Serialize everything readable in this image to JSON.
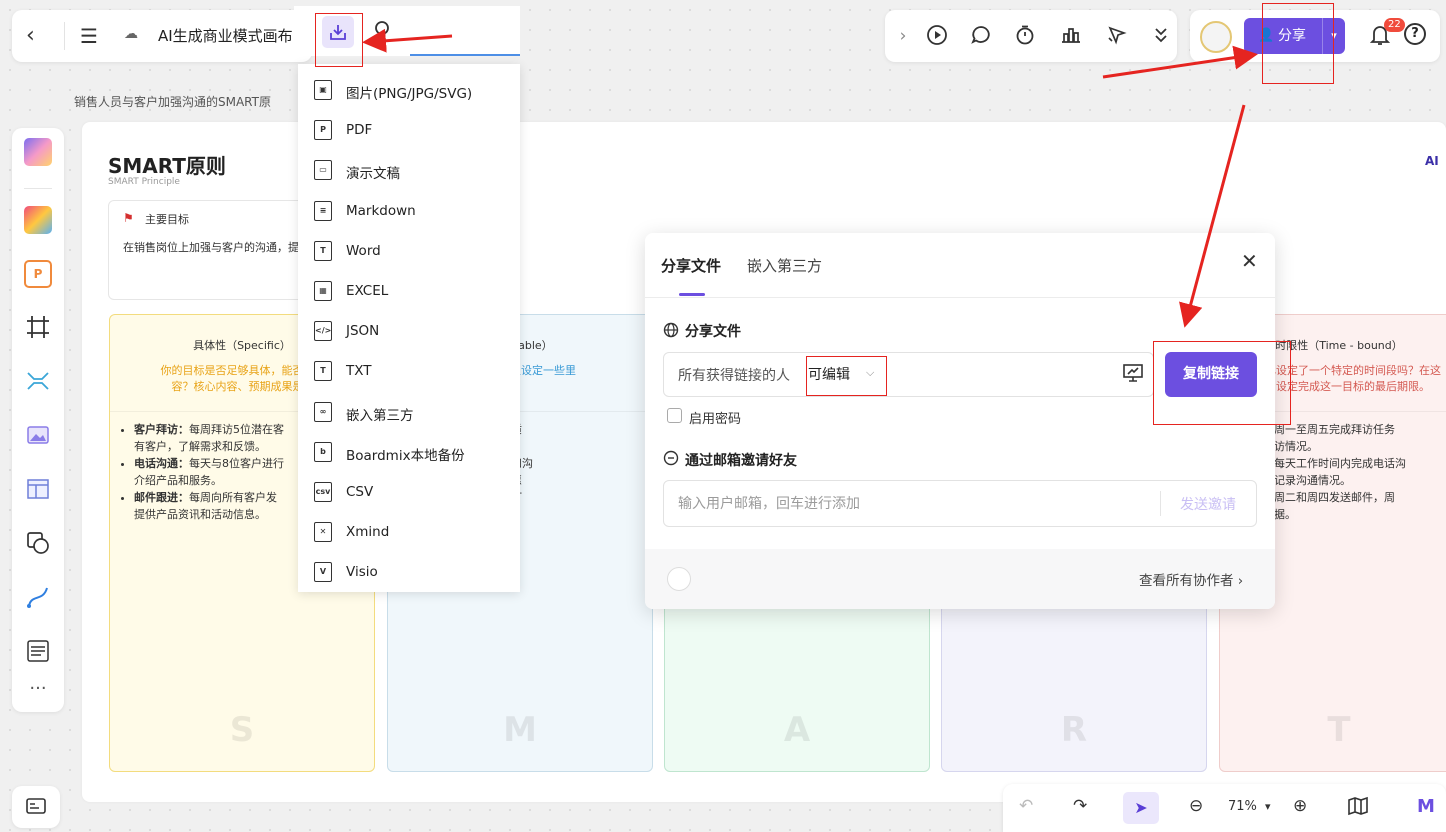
{
  "topbar": {
    "back": "‹",
    "menu": "☰",
    "cloud": "☁",
    "doc_title": "AI生成商业模式画布",
    "tools": [
      "play-icon",
      "comment-icon",
      "timer-icon",
      "vote-icon",
      "laser-pointer-icon",
      "collapse-icon"
    ],
    "chevron": "›",
    "share_label": "分享",
    "notification_count": "22",
    "help": "?"
  },
  "canvas": {
    "breadcrumb": "销售人员与客户加强沟通的SMART原",
    "title": "SMART原则",
    "subtitle": "SMART Principle",
    "logo_text": "AI",
    "goal": {
      "label": "主要目标",
      "text": "在销售岗位上加强与客户的沟通，提"
    },
    "columns": [
      {
        "letter": "S",
        "header": "具体性（Specific）",
        "question": "你的目标是否足够具体，能否清楚\n容？核心内容、预期成果是什",
        "bullets": [
          {
            "head": "客户拜访：",
            "text": "每周拜访5位潜在客\n有客户，了解需求和反馈。"
          },
          {
            "head": "电话沟通：",
            "text": "每天与8位客户进行\n介绍产品和服务。"
          },
          {
            "head": "邮件跟进：",
            "text": "每周向所有客户发\n提供产品资讯和活动信息。"
          }
        ]
      },
      {
        "letter": "M",
        "header": "easurable）",
        "question": "动？在这里设定一些里",
        "bullets": [
          {
            "head": "",
            "text": "计拜访客户的数量和质\n反馈和意向程度评估。"
          },
          {
            "head": "",
            "text": "通话沟通的客户数量和沟\n客户的兴趣和购买意愿"
          },
          {
            "head": "",
            "text": "计邮件的发送数量和打"
          }
        ]
      },
      {
        "letter": "A",
        "header": "",
        "question": "",
        "bullets": []
      },
      {
        "letter": "R",
        "header": "",
        "question": "",
        "bullets": []
      },
      {
        "letter": "T",
        "header": "时限性（Time - bound）",
        "question": "已设定了一个特定的时间段吗？在这\n设定完成这一目标的最后期限。",
        "bullets": [
          {
            "head": "拜访：",
            "text": "每周一至周五完成拜访任务\n六统计拜访情况。"
          },
          {
            "head": "话沟通：",
            "text": "每天工作时间内完成电话沟\n，下班前记录沟通情况。"
          },
          {
            "head": "跟进：",
            "text": "每周二和周四发送邮件，周\n计邮件数据。"
          }
        ]
      }
    ]
  },
  "export_menu": {
    "items": [
      {
        "icon": "image-icon",
        "glyph": "▣",
        "label": "图片(PNG/JPG/SVG)"
      },
      {
        "icon": "pdf-icon",
        "glyph": "P",
        "label": "PDF"
      },
      {
        "icon": "presentation-icon",
        "glyph": "▭",
        "label": "演示文稿"
      },
      {
        "icon": "markdown-icon",
        "glyph": "≡",
        "label": "Markdown"
      },
      {
        "icon": "word-icon",
        "glyph": "T",
        "label": "Word"
      },
      {
        "icon": "excel-icon",
        "glyph": "▦",
        "label": "EXCEL"
      },
      {
        "icon": "json-icon",
        "glyph": "</>",
        "label": "JSON"
      },
      {
        "icon": "txt-icon",
        "glyph": "T",
        "label": "TXT"
      },
      {
        "icon": "embed-icon",
        "glyph": "∞",
        "label": "嵌入第三方"
      },
      {
        "icon": "boardmix-backup-icon",
        "glyph": "b",
        "label": "Boardmix本地备份"
      },
      {
        "icon": "csv-icon",
        "glyph": "csv",
        "label": "CSV"
      },
      {
        "icon": "xmind-icon",
        "glyph": "✕",
        "label": "Xmind"
      },
      {
        "icon": "visio-icon",
        "glyph": "V",
        "label": "Visio"
      }
    ]
  },
  "share_dialog": {
    "tab_share": "分享文件",
    "tab_embed": "嵌入第三方",
    "close": "✕",
    "section_share": "分享文件",
    "link_audience": "所有获得链接的人",
    "link_permission": "可编辑",
    "copy_link": "复制链接",
    "enable_password": "启用密码",
    "section_invite": "通过邮箱邀请好友",
    "email_placeholder": "输入用户邮箱，回车进行添加",
    "send_invite": "发送邀请",
    "view_collaborators": "查看所有协作者 ›"
  },
  "bottombar": {
    "zoom": "71%"
  },
  "colors": {
    "accent": "#6c4fe0",
    "annotation_red": "#e52420"
  }
}
